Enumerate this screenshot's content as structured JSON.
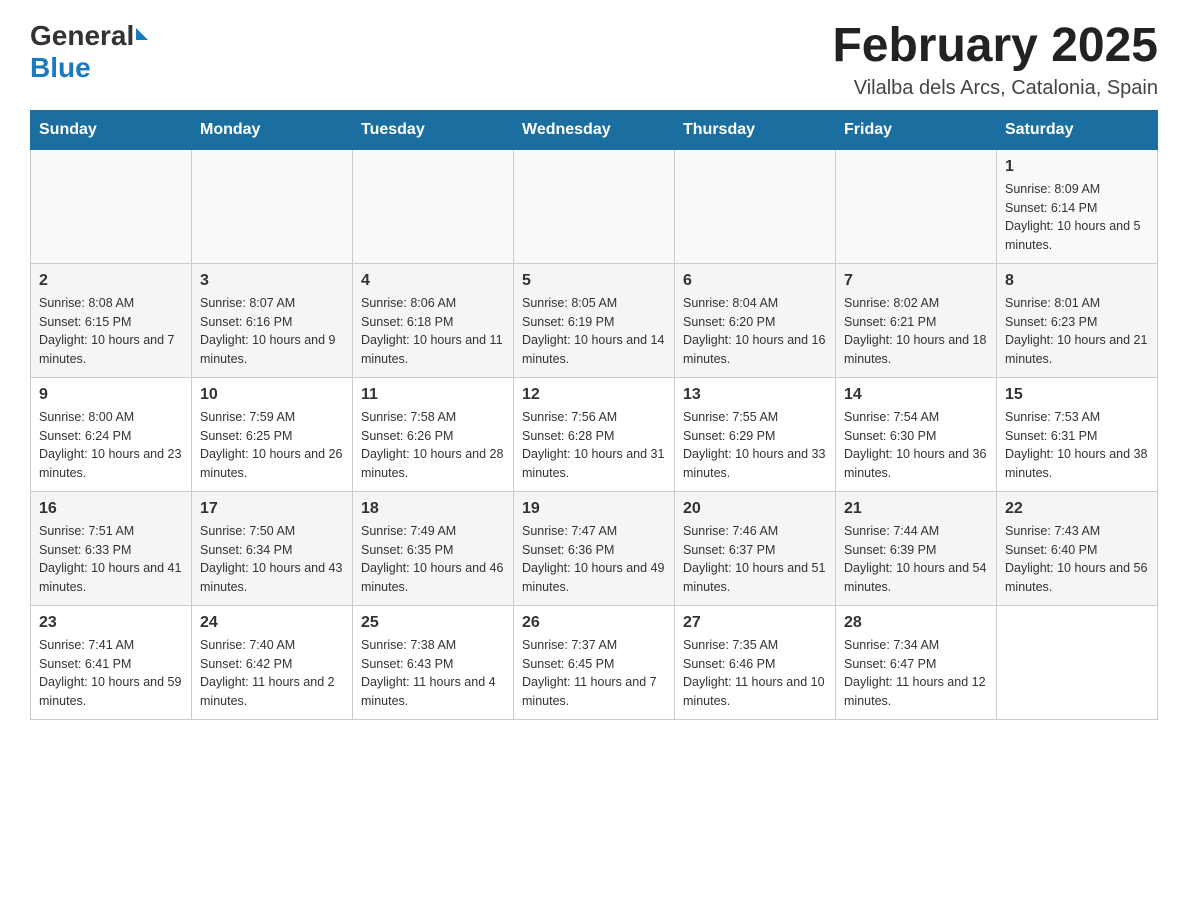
{
  "header": {
    "logo_general": "General",
    "logo_blue": "Blue",
    "month_year": "February 2025",
    "location": "Vilalba dels Arcs, Catalonia, Spain"
  },
  "weekdays": [
    "Sunday",
    "Monday",
    "Tuesday",
    "Wednesday",
    "Thursday",
    "Friday",
    "Saturday"
  ],
  "weeks": [
    [
      {
        "day": "",
        "sunrise": "",
        "sunset": "",
        "daylight": ""
      },
      {
        "day": "",
        "sunrise": "",
        "sunset": "",
        "daylight": ""
      },
      {
        "day": "",
        "sunrise": "",
        "sunset": "",
        "daylight": ""
      },
      {
        "day": "",
        "sunrise": "",
        "sunset": "",
        "daylight": ""
      },
      {
        "day": "",
        "sunrise": "",
        "sunset": "",
        "daylight": ""
      },
      {
        "day": "",
        "sunrise": "",
        "sunset": "",
        "daylight": ""
      },
      {
        "day": "1",
        "sunrise": "Sunrise: 8:09 AM",
        "sunset": "Sunset: 6:14 PM",
        "daylight": "Daylight: 10 hours and 5 minutes."
      }
    ],
    [
      {
        "day": "2",
        "sunrise": "Sunrise: 8:08 AM",
        "sunset": "Sunset: 6:15 PM",
        "daylight": "Daylight: 10 hours and 7 minutes."
      },
      {
        "day": "3",
        "sunrise": "Sunrise: 8:07 AM",
        "sunset": "Sunset: 6:16 PM",
        "daylight": "Daylight: 10 hours and 9 minutes."
      },
      {
        "day": "4",
        "sunrise": "Sunrise: 8:06 AM",
        "sunset": "Sunset: 6:18 PM",
        "daylight": "Daylight: 10 hours and 11 minutes."
      },
      {
        "day": "5",
        "sunrise": "Sunrise: 8:05 AM",
        "sunset": "Sunset: 6:19 PM",
        "daylight": "Daylight: 10 hours and 14 minutes."
      },
      {
        "day": "6",
        "sunrise": "Sunrise: 8:04 AM",
        "sunset": "Sunset: 6:20 PM",
        "daylight": "Daylight: 10 hours and 16 minutes."
      },
      {
        "day": "7",
        "sunrise": "Sunrise: 8:02 AM",
        "sunset": "Sunset: 6:21 PM",
        "daylight": "Daylight: 10 hours and 18 minutes."
      },
      {
        "day": "8",
        "sunrise": "Sunrise: 8:01 AM",
        "sunset": "Sunset: 6:23 PM",
        "daylight": "Daylight: 10 hours and 21 minutes."
      }
    ],
    [
      {
        "day": "9",
        "sunrise": "Sunrise: 8:00 AM",
        "sunset": "Sunset: 6:24 PM",
        "daylight": "Daylight: 10 hours and 23 minutes."
      },
      {
        "day": "10",
        "sunrise": "Sunrise: 7:59 AM",
        "sunset": "Sunset: 6:25 PM",
        "daylight": "Daylight: 10 hours and 26 minutes."
      },
      {
        "day": "11",
        "sunrise": "Sunrise: 7:58 AM",
        "sunset": "Sunset: 6:26 PM",
        "daylight": "Daylight: 10 hours and 28 minutes."
      },
      {
        "day": "12",
        "sunrise": "Sunrise: 7:56 AM",
        "sunset": "Sunset: 6:28 PM",
        "daylight": "Daylight: 10 hours and 31 minutes."
      },
      {
        "day": "13",
        "sunrise": "Sunrise: 7:55 AM",
        "sunset": "Sunset: 6:29 PM",
        "daylight": "Daylight: 10 hours and 33 minutes."
      },
      {
        "day": "14",
        "sunrise": "Sunrise: 7:54 AM",
        "sunset": "Sunset: 6:30 PM",
        "daylight": "Daylight: 10 hours and 36 minutes."
      },
      {
        "day": "15",
        "sunrise": "Sunrise: 7:53 AM",
        "sunset": "Sunset: 6:31 PM",
        "daylight": "Daylight: 10 hours and 38 minutes."
      }
    ],
    [
      {
        "day": "16",
        "sunrise": "Sunrise: 7:51 AM",
        "sunset": "Sunset: 6:33 PM",
        "daylight": "Daylight: 10 hours and 41 minutes."
      },
      {
        "day": "17",
        "sunrise": "Sunrise: 7:50 AM",
        "sunset": "Sunset: 6:34 PM",
        "daylight": "Daylight: 10 hours and 43 minutes."
      },
      {
        "day": "18",
        "sunrise": "Sunrise: 7:49 AM",
        "sunset": "Sunset: 6:35 PM",
        "daylight": "Daylight: 10 hours and 46 minutes."
      },
      {
        "day": "19",
        "sunrise": "Sunrise: 7:47 AM",
        "sunset": "Sunset: 6:36 PM",
        "daylight": "Daylight: 10 hours and 49 minutes."
      },
      {
        "day": "20",
        "sunrise": "Sunrise: 7:46 AM",
        "sunset": "Sunset: 6:37 PM",
        "daylight": "Daylight: 10 hours and 51 minutes."
      },
      {
        "day": "21",
        "sunrise": "Sunrise: 7:44 AM",
        "sunset": "Sunset: 6:39 PM",
        "daylight": "Daylight: 10 hours and 54 minutes."
      },
      {
        "day": "22",
        "sunrise": "Sunrise: 7:43 AM",
        "sunset": "Sunset: 6:40 PM",
        "daylight": "Daylight: 10 hours and 56 minutes."
      }
    ],
    [
      {
        "day": "23",
        "sunrise": "Sunrise: 7:41 AM",
        "sunset": "Sunset: 6:41 PM",
        "daylight": "Daylight: 10 hours and 59 minutes."
      },
      {
        "day": "24",
        "sunrise": "Sunrise: 7:40 AM",
        "sunset": "Sunset: 6:42 PM",
        "daylight": "Daylight: 11 hours and 2 minutes."
      },
      {
        "day": "25",
        "sunrise": "Sunrise: 7:38 AM",
        "sunset": "Sunset: 6:43 PM",
        "daylight": "Daylight: 11 hours and 4 minutes."
      },
      {
        "day": "26",
        "sunrise": "Sunrise: 7:37 AM",
        "sunset": "Sunset: 6:45 PM",
        "daylight": "Daylight: 11 hours and 7 minutes."
      },
      {
        "day": "27",
        "sunrise": "Sunrise: 7:35 AM",
        "sunset": "Sunset: 6:46 PM",
        "daylight": "Daylight: 11 hours and 10 minutes."
      },
      {
        "day": "28",
        "sunrise": "Sunrise: 7:34 AM",
        "sunset": "Sunset: 6:47 PM",
        "daylight": "Daylight: 11 hours and 12 minutes."
      },
      {
        "day": "",
        "sunrise": "",
        "sunset": "",
        "daylight": ""
      }
    ]
  ]
}
